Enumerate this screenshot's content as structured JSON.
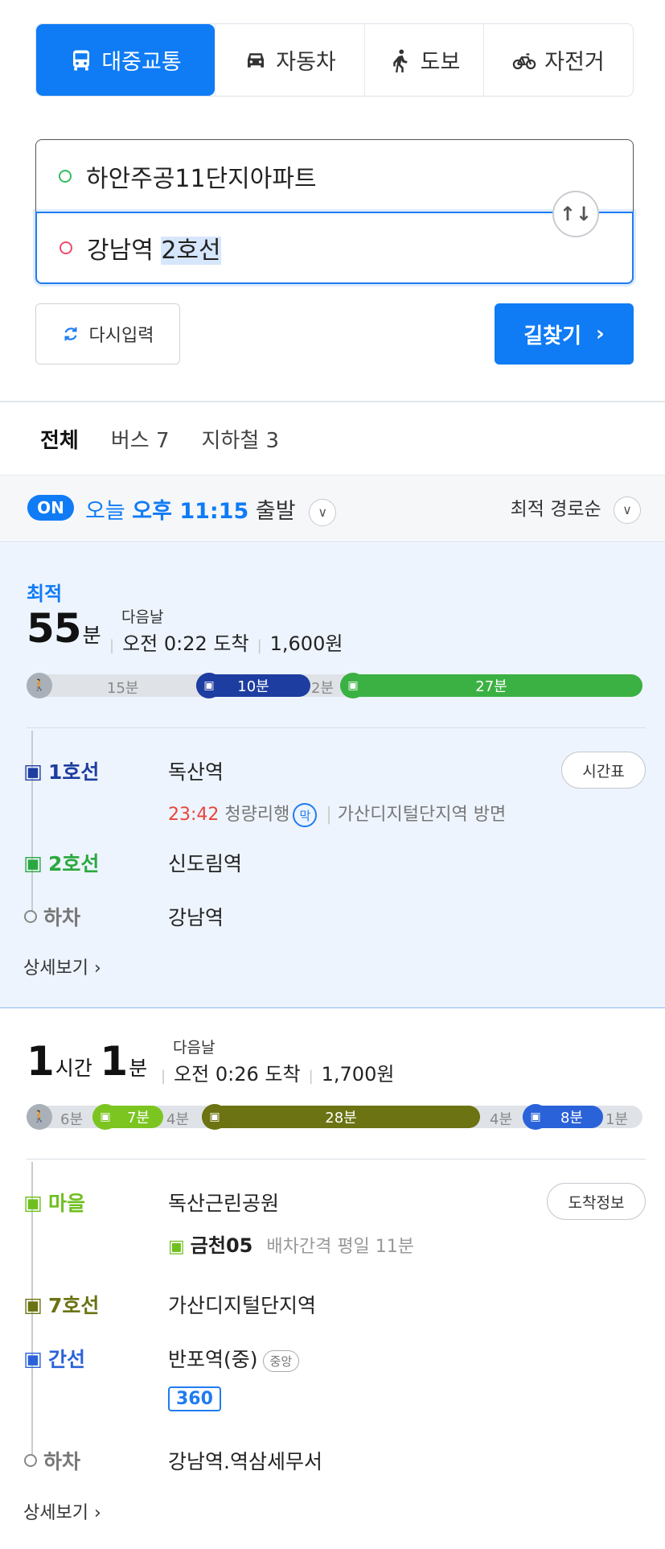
{
  "modes": {
    "transit": "대중교통",
    "car": "자동차",
    "walk": "도보",
    "bike": "자전거"
  },
  "search": {
    "origin": "하안주공11단지아파트",
    "dest_part1": "강남역 ",
    "dest_part2": "2호선",
    "reset_label": "다시입력",
    "go_label": "길찾기"
  },
  "result_tabs": {
    "all": "전체",
    "bus": "버스 7",
    "subway": "지하철 3"
  },
  "timebar": {
    "on_badge": "ON",
    "day": "오늘",
    "time": "오후 11:15",
    "depart": "출발",
    "sort": "최적 경로순"
  },
  "route1": {
    "best_label": "최적",
    "duration_num": "55",
    "duration_unit": "분",
    "next_day": "다음날",
    "arrival": "오전 0:22 도착",
    "fare": "1,600원",
    "bar": {
      "walk": "15분",
      "bus": "10분",
      "transfer": "2분",
      "subway": "27분"
    },
    "steps": [
      {
        "label": "1호선",
        "stop": "독산역",
        "color": "#1e3da0"
      },
      {
        "label": "2호선",
        "stop": "신도림역",
        "color": "#2aa83f"
      },
      {
        "label": "하차",
        "stop": "강남역",
        "color": "#777777"
      }
    ],
    "timetable_btn": "시간표",
    "sub_time": "23:42",
    "sub_dest": "청량리행",
    "mak": "막",
    "sub_dir": "가산디지털단지역 방면",
    "detail": "상세보기"
  },
  "route2": {
    "hours_num": "1",
    "hours_unit": "시간",
    "mins_num": "1",
    "mins_unit": "분",
    "next_day": "다음날",
    "arrival": "오전 0:26 도착",
    "fare": "1,700원",
    "bar": {
      "walk1": "6분",
      "bus1": "7분",
      "t1": "4분",
      "subway": "28분",
      "t2": "4분",
      "bus2": "8분",
      "walk2": "1분"
    },
    "steps": [
      {
        "label": "마을",
        "stop": "독산근린공원",
        "color": "#6fbf1f"
      },
      {
        "label": "7호선",
        "stop": "가산디지털단지역",
        "color": "#6b7312"
      },
      {
        "label": "간선",
        "stop": "반포역(중)",
        "color": "#2a62d9"
      },
      {
        "label": "하차",
        "stop": "강남역.역삼세무서",
        "color": "#777777"
      }
    ],
    "arrival_btn": "도착정보",
    "bus_no": "금천05",
    "interval": "배차간격 평일 11분",
    "center_badge": "중앙",
    "route_no": "360",
    "detail": "상세보기"
  },
  "colors": {
    "accent": "#0f7bf5",
    "line1": "#1e3da0",
    "line2": "#2aa83f",
    "village": "#6fbf1f",
    "line7": "#6b7312",
    "trunk": "#2a62d9"
  }
}
